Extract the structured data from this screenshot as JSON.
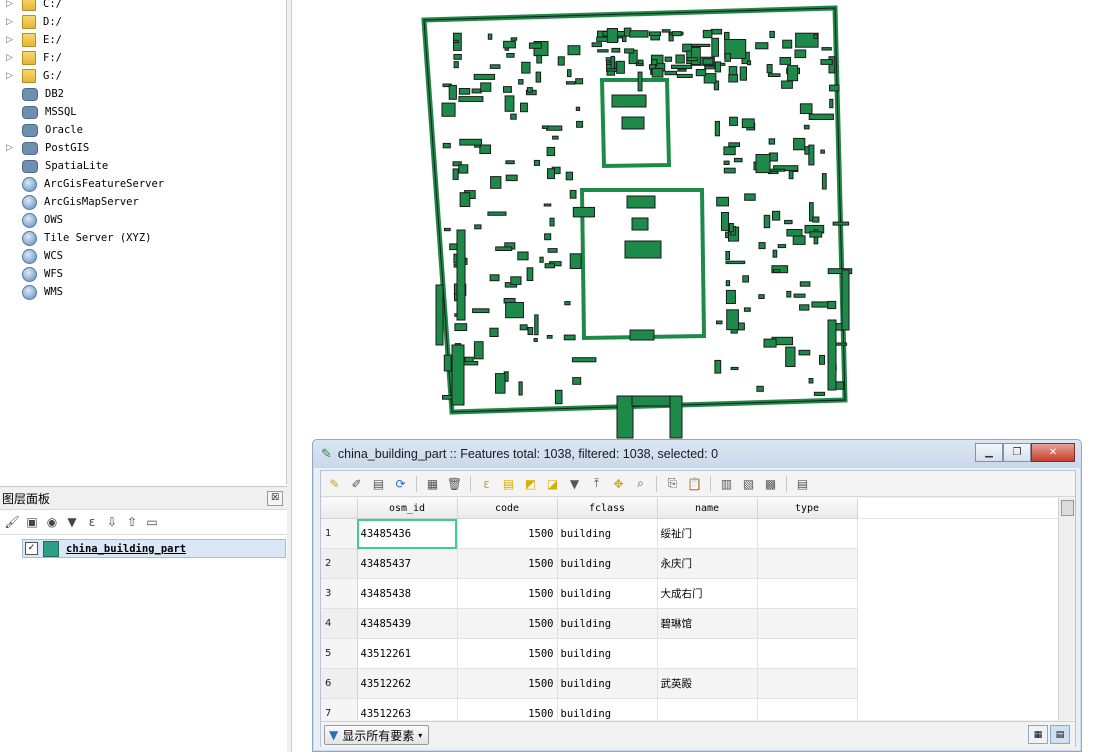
{
  "browser": {
    "items": [
      {
        "label": "C:/",
        "icon": "folder-icon",
        "arrow": true
      },
      {
        "label": "D:/",
        "icon": "folder-icon",
        "arrow": true
      },
      {
        "label": "E:/",
        "icon": "folder-icon",
        "arrow": true
      },
      {
        "label": "F:/",
        "icon": "folder-icon",
        "arrow": true
      },
      {
        "label": "G:/",
        "icon": "folder-icon",
        "arrow": true
      },
      {
        "label": "DB2",
        "icon": "db2-icon",
        "arrow": false
      },
      {
        "label": "MSSQL",
        "icon": "mssql-icon",
        "arrow": false
      },
      {
        "label": "Oracle",
        "icon": "oracle-icon",
        "arrow": false
      },
      {
        "label": "PostGIS",
        "icon": "postgis-icon",
        "arrow": true
      },
      {
        "label": "SpatiaLite",
        "icon": "spatialite-icon",
        "arrow": false
      },
      {
        "label": "ArcGisFeatureServer",
        "icon": "arcgis-feature-icon",
        "arrow": false
      },
      {
        "label": "ArcGisMapServer",
        "icon": "arcgis-map-icon",
        "arrow": false
      },
      {
        "label": "OWS",
        "icon": "ows-icon",
        "arrow": false
      },
      {
        "label": "Tile Server (XYZ)",
        "icon": "xyz-icon",
        "arrow": false
      },
      {
        "label": "WCS",
        "icon": "wcs-icon",
        "arrow": false
      },
      {
        "label": "WFS",
        "icon": "wfs-icon",
        "arrow": false
      },
      {
        "label": "WMS",
        "icon": "wms-icon",
        "arrow": false
      }
    ]
  },
  "layers_panel": {
    "title": "图层面板",
    "close_label": "☒",
    "layer": {
      "name": "china_building_part",
      "checked": true,
      "color": "#2e9e84"
    }
  },
  "map": {
    "fill_color": "#1e8a4a",
    "stroke_color": "#1a1a1a"
  },
  "attribute_table": {
    "title": "china_building_part :: Features total: 1038, filtered: 1038, selected: 0",
    "columns": [
      "osm_id",
      "code",
      "fclass",
      "name",
      "type"
    ],
    "rows": [
      {
        "n": "1",
        "osm_id": "43485436",
        "code": "1500",
        "fclass": "building",
        "name": "绥祉门",
        "type": ""
      },
      {
        "n": "2",
        "osm_id": "43485437",
        "code": "1500",
        "fclass": "building",
        "name": "永庆门",
        "type": ""
      },
      {
        "n": "3",
        "osm_id": "43485438",
        "code": "1500",
        "fclass": "building",
        "name": "大成右门",
        "type": ""
      },
      {
        "n": "4",
        "osm_id": "43485439",
        "code": "1500",
        "fclass": "building",
        "name": "碧琳馆",
        "type": ""
      },
      {
        "n": "5",
        "osm_id": "43512261",
        "code": "1500",
        "fclass": "building",
        "name": "",
        "type": ""
      },
      {
        "n": "6",
        "osm_id": "43512262",
        "code": "1500",
        "fclass": "building",
        "name": "武英殿",
        "type": ""
      },
      {
        "n": "7",
        "osm_id": "43512263",
        "code": "1500",
        "fclass": "building",
        "name": "",
        "type": ""
      }
    ],
    "show_all_label": "显示所有要素"
  }
}
